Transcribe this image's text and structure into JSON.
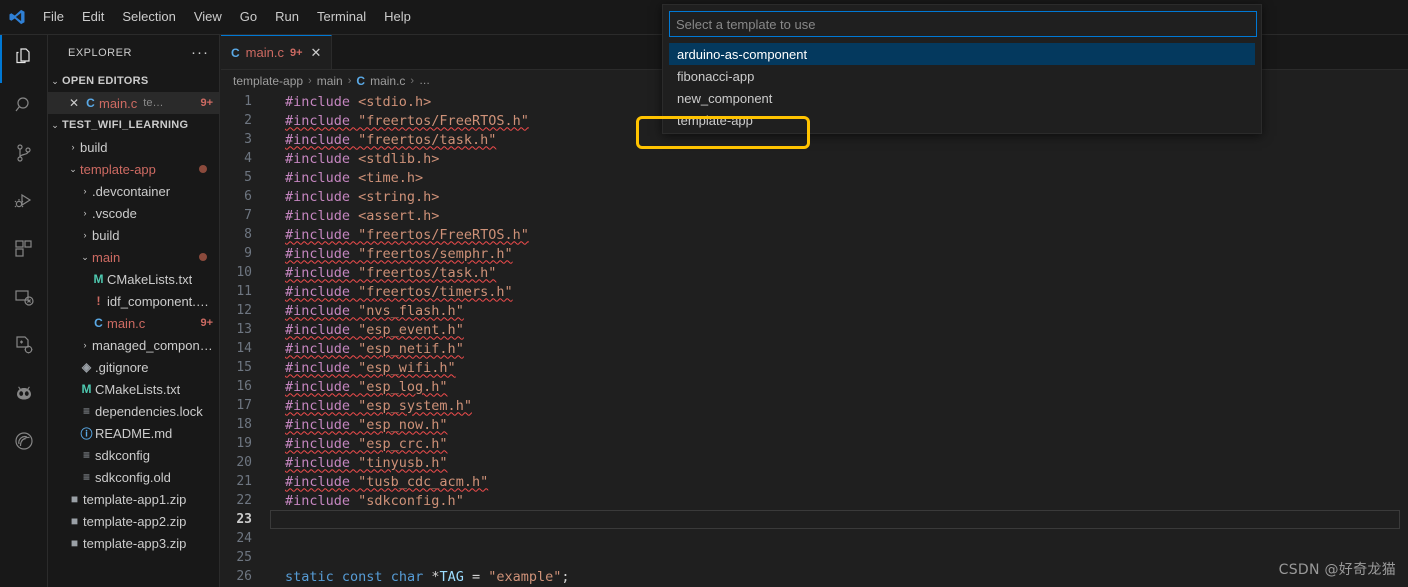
{
  "window": {
    "logo_icon": "vscode-logo-icon",
    "menus": [
      "File",
      "Edit",
      "Selection",
      "View",
      "Go",
      "Run",
      "Terminal",
      "Help"
    ]
  },
  "activity_bar": {
    "items": [
      {
        "name": "explorer-icon",
        "active": true
      },
      {
        "name": "search-icon",
        "active": false
      },
      {
        "name": "source-control-icon",
        "active": false
      },
      {
        "name": "run-and-debug-icon",
        "active": false
      },
      {
        "name": "extensions-icon",
        "active": false
      },
      {
        "name": "remote-explorer-icon",
        "active": false
      },
      {
        "name": "esp-idf-icon",
        "active": false
      },
      {
        "name": "platformio-alien-icon",
        "active": false
      },
      {
        "name": "espressif-icon",
        "active": false
      }
    ]
  },
  "sidebar": {
    "title": "EXPLORER",
    "more_actions": "···",
    "open_editors": {
      "label": "OPEN EDITORS",
      "expanded": true,
      "items": [
        {
          "name": "main.c",
          "sub": "te…",
          "badge": "9+",
          "icon": "c-file-icon",
          "selected": true
        }
      ]
    },
    "workspace": {
      "label": "TEST_WIFI_LEARNING",
      "expanded": true,
      "tree": [
        {
          "label": "build",
          "depth": 1,
          "kind": "folder",
          "expanded": false
        },
        {
          "label": "template-app",
          "depth": 1,
          "kind": "folder",
          "expanded": true,
          "modified": true,
          "color": "mod"
        },
        {
          "label": ".devcontainer",
          "depth": 2,
          "kind": "folder",
          "expanded": false
        },
        {
          "label": ".vscode",
          "depth": 2,
          "kind": "folder",
          "expanded": false
        },
        {
          "label": "build",
          "depth": 2,
          "kind": "folder",
          "expanded": false
        },
        {
          "label": "main",
          "depth": 2,
          "kind": "folder",
          "expanded": true,
          "modified": true,
          "color": "mod"
        },
        {
          "label": "CMakeLists.txt",
          "depth": 3,
          "kind": "file",
          "icon": "M",
          "icon_color": "teal"
        },
        {
          "label": "idf_component.yml",
          "depth": 3,
          "kind": "file",
          "icon": "!",
          "icon_color": "mod"
        },
        {
          "label": "main.c",
          "depth": 3,
          "kind": "file",
          "icon": "C",
          "icon_color": "blue",
          "color": "mod",
          "badge": "9+"
        },
        {
          "label": "managed_compone…",
          "depth": 2,
          "kind": "folder",
          "expanded": false
        },
        {
          "label": ".gitignore",
          "depth": 2,
          "kind": "file",
          "icon": "◈",
          "icon_color": "grey"
        },
        {
          "label": "CMakeLists.txt",
          "depth": 2,
          "kind": "file",
          "icon": "M",
          "icon_color": "teal"
        },
        {
          "label": "dependencies.lock",
          "depth": 2,
          "kind": "file",
          "icon": "≡",
          "icon_color": "grey"
        },
        {
          "label": "README.md",
          "depth": 2,
          "kind": "file",
          "icon": "ⓘ",
          "icon_color": "blue"
        },
        {
          "label": "sdkconfig",
          "depth": 2,
          "kind": "file",
          "icon": "≡",
          "icon_color": "grey"
        },
        {
          "label": "sdkconfig.old",
          "depth": 2,
          "kind": "file",
          "icon": "≡",
          "icon_color": "grey"
        },
        {
          "label": "template-app1.zip",
          "depth": 1,
          "kind": "file",
          "icon": "■",
          "icon_color": "grey"
        },
        {
          "label": "template-app2.zip",
          "depth": 1,
          "kind": "file",
          "icon": "■",
          "icon_color": "grey"
        },
        {
          "label": "template-app3.zip",
          "depth": 1,
          "kind": "file",
          "icon": "■",
          "icon_color": "grey"
        }
      ]
    }
  },
  "editor": {
    "tabs": [
      {
        "icon": "c-file-icon",
        "name": "main.c",
        "badge": "9+",
        "close": "✕",
        "active": true
      }
    ],
    "breadcrumb": [
      "template-app",
      "main",
      "main.c",
      "…"
    ],
    "breadcrumb_sep": "›",
    "current_line": 23,
    "lines": [
      {
        "n": 1,
        "segs": [
          {
            "t": "#include ",
            "c": "kw-pre"
          },
          {
            "t": "<stdio.h>",
            "c": "str-ang"
          }
        ]
      },
      {
        "n": 2,
        "segs": [
          {
            "t": "#include ",
            "c": "kw-pre"
          },
          {
            "t": "\"freertos/FreeRTOS.h\"",
            "c": "str-q"
          }
        ],
        "error": true
      },
      {
        "n": 3,
        "segs": [
          {
            "t": "#include ",
            "c": "kw-pre"
          },
          {
            "t": "\"freertos/task.h\"",
            "c": "str-q"
          }
        ],
        "error": true
      },
      {
        "n": 4,
        "segs": [
          {
            "t": "#include ",
            "c": "kw-pre"
          },
          {
            "t": "<stdlib.h>",
            "c": "str-ang"
          }
        ]
      },
      {
        "n": 5,
        "segs": [
          {
            "t": "#include ",
            "c": "kw-pre"
          },
          {
            "t": "<time.h>",
            "c": "str-ang"
          }
        ]
      },
      {
        "n": 6,
        "segs": [
          {
            "t": "#include ",
            "c": "kw-pre"
          },
          {
            "t": "<string.h>",
            "c": "str-ang"
          }
        ]
      },
      {
        "n": 7,
        "segs": [
          {
            "t": "#include ",
            "c": "kw-pre"
          },
          {
            "t": "<assert.h>",
            "c": "str-ang"
          }
        ]
      },
      {
        "n": 8,
        "segs": [
          {
            "t": "#include ",
            "c": "kw-pre"
          },
          {
            "t": "\"freertos/FreeRTOS.h\"",
            "c": "str-q"
          }
        ],
        "error": true
      },
      {
        "n": 9,
        "segs": [
          {
            "t": "#include ",
            "c": "kw-pre"
          },
          {
            "t": "\"freertos/semphr.h\"",
            "c": "str-q"
          }
        ],
        "error": true
      },
      {
        "n": 10,
        "segs": [
          {
            "t": "#include ",
            "c": "kw-pre"
          },
          {
            "t": "\"freertos/task.h\"",
            "c": "str-q"
          }
        ],
        "error": true
      },
      {
        "n": 11,
        "segs": [
          {
            "t": "#include ",
            "c": "kw-pre"
          },
          {
            "t": "\"freertos/timers.h\"",
            "c": "str-q"
          }
        ],
        "error": true
      },
      {
        "n": 12,
        "segs": [
          {
            "t": "#include ",
            "c": "kw-pre"
          },
          {
            "t": "\"nvs_flash.h\"",
            "c": "str-q"
          }
        ],
        "error": true
      },
      {
        "n": 13,
        "segs": [
          {
            "t": "#include ",
            "c": "kw-pre"
          },
          {
            "t": "\"esp_event.h\"",
            "c": "str-q"
          }
        ],
        "error": true
      },
      {
        "n": 14,
        "segs": [
          {
            "t": "#include ",
            "c": "kw-pre"
          },
          {
            "t": "\"esp_netif.h\"",
            "c": "str-q"
          }
        ],
        "error": true
      },
      {
        "n": 15,
        "segs": [
          {
            "t": "#include ",
            "c": "kw-pre"
          },
          {
            "t": "\"esp_wifi.h\"",
            "c": "str-q"
          }
        ],
        "error": true
      },
      {
        "n": 16,
        "segs": [
          {
            "t": "#include ",
            "c": "kw-pre"
          },
          {
            "t": "\"esp_log.h\"",
            "c": "str-q"
          }
        ],
        "error": true
      },
      {
        "n": 17,
        "segs": [
          {
            "t": "#include ",
            "c": "kw-pre"
          },
          {
            "t": "\"esp_system.h\"",
            "c": "str-q"
          }
        ],
        "error": true
      },
      {
        "n": 18,
        "segs": [
          {
            "t": "#include ",
            "c": "kw-pre"
          },
          {
            "t": "\"esp_now.h\"",
            "c": "str-q"
          }
        ],
        "error": true
      },
      {
        "n": 19,
        "segs": [
          {
            "t": "#include ",
            "c": "kw-pre"
          },
          {
            "t": "\"esp_crc.h\"",
            "c": "str-q"
          }
        ],
        "error": true
      },
      {
        "n": 20,
        "segs": [
          {
            "t": "#include ",
            "c": "kw-pre"
          },
          {
            "t": "\"tinyusb.h\"",
            "c": "str-q"
          }
        ],
        "error": true
      },
      {
        "n": 21,
        "segs": [
          {
            "t": "#include ",
            "c": "kw-pre"
          },
          {
            "t": "\"tusb_cdc_acm.h\"",
            "c": "str-q"
          }
        ],
        "error": true
      },
      {
        "n": 22,
        "segs": [
          {
            "t": "#include ",
            "c": "kw-pre"
          },
          {
            "t": "\"sdkconfig.h\"",
            "c": "str-q"
          }
        ]
      },
      {
        "n": 23,
        "segs": []
      },
      {
        "n": 24,
        "segs": []
      },
      {
        "n": 25,
        "segs": []
      },
      {
        "n": 26,
        "segs": [
          {
            "t": "static ",
            "c": "kw-sta"
          },
          {
            "t": "const ",
            "c": "kw-sta"
          },
          {
            "t": "char ",
            "c": "kw-sta"
          },
          {
            "t": "*",
            "c": "punc"
          },
          {
            "t": "TAG",
            "c": "ident"
          },
          {
            "t": " = ",
            "c": "punc"
          },
          {
            "t": "\"example\"",
            "c": "str-q"
          },
          {
            "t": ";",
            "c": "punc"
          }
        ]
      }
    ]
  },
  "quick_pick": {
    "placeholder": "Select a template to use",
    "value": "",
    "items": [
      {
        "label": "arduino-as-component",
        "focused": true
      },
      {
        "label": "fibonacci-app",
        "focused": false
      },
      {
        "label": "new_component",
        "focused": false
      },
      {
        "label": "template-app",
        "focused": false,
        "annotated": true
      }
    ]
  },
  "annotation": {
    "color": "#ffc300",
    "target": "template-app"
  },
  "watermark": {
    "text": "CSDN @好奇龙猫"
  }
}
